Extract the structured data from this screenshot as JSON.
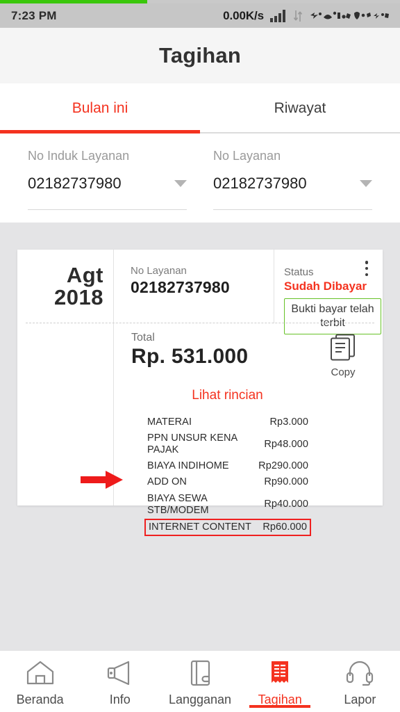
{
  "status_bar": {
    "time": "7:23 PM",
    "network_speed": "0.00K/s",
    "icons": [
      "signal-bars-icon",
      "data-transfer-icon",
      "notification-cluster-icon"
    ]
  },
  "progress": {
    "percent": 37,
    "color": "#3ac70b"
  },
  "header": {
    "title": "Tagihan"
  },
  "tabs": {
    "items": [
      {
        "label": "Bulan ini",
        "active": true
      },
      {
        "label": "Riwayat",
        "active": false
      }
    ],
    "active_color": "#f4321f"
  },
  "selectors": [
    {
      "label": "No Induk Layanan",
      "value": "02182737980"
    },
    {
      "label": "No Layanan",
      "value": "02182737980"
    }
  ],
  "bill_card": {
    "period_month": "Agt",
    "period_year": "2018",
    "account_label": "No Layanan",
    "account_value": "02182737980",
    "status_label": "Status",
    "status_value": "Sudah Dibayar",
    "status_color": "#f4321f",
    "proof_badge": "Bukti bayar telah terbit",
    "proof_badge_border_color": "#66c226",
    "menu_icon": "kebab-menu-icon",
    "total_label": "Total",
    "total_amount": "Rp. 531.000",
    "copy_label": "Copy",
    "copy_icon": "copy-document-icon",
    "detail_link": "Lihat rincian",
    "items": [
      {
        "name": "MATERAI",
        "amount": "Rp3.000",
        "highlighted": false
      },
      {
        "name": "PPN UNSUR KENA PAJAK",
        "amount": "Rp48.000",
        "highlighted": false
      },
      {
        "name": "BIAYA INDIHOME",
        "amount": "Rp290.000",
        "highlighted": false
      },
      {
        "name": "ADD ON",
        "amount": "Rp90.000",
        "highlighted": false
      },
      {
        "name": "BIAYA SEWA STB/MODEM",
        "amount": "Rp40.000",
        "highlighted": false
      },
      {
        "name": "INTERNET CONTENT",
        "amount": "Rp60.000",
        "highlighted": true
      }
    ],
    "highlight_color": "#ef2020"
  },
  "annotation": {
    "arrow_icon": "red-right-arrow-icon",
    "arrow_color": "#ee1b1b",
    "points_to": "INTERNET CONTENT"
  },
  "bottom_nav": {
    "items": [
      {
        "label": "Beranda",
        "icon": "home-icon",
        "active": false
      },
      {
        "label": "Info",
        "icon": "megaphone-icon",
        "active": false
      },
      {
        "label": "Langganan",
        "icon": "notebook-icon",
        "active": false
      },
      {
        "label": "Tagihan",
        "icon": "receipt-icon",
        "active": true
      },
      {
        "label": "Lapor",
        "icon": "headset-icon",
        "active": false
      }
    ],
    "active_color": "#f4321f"
  }
}
